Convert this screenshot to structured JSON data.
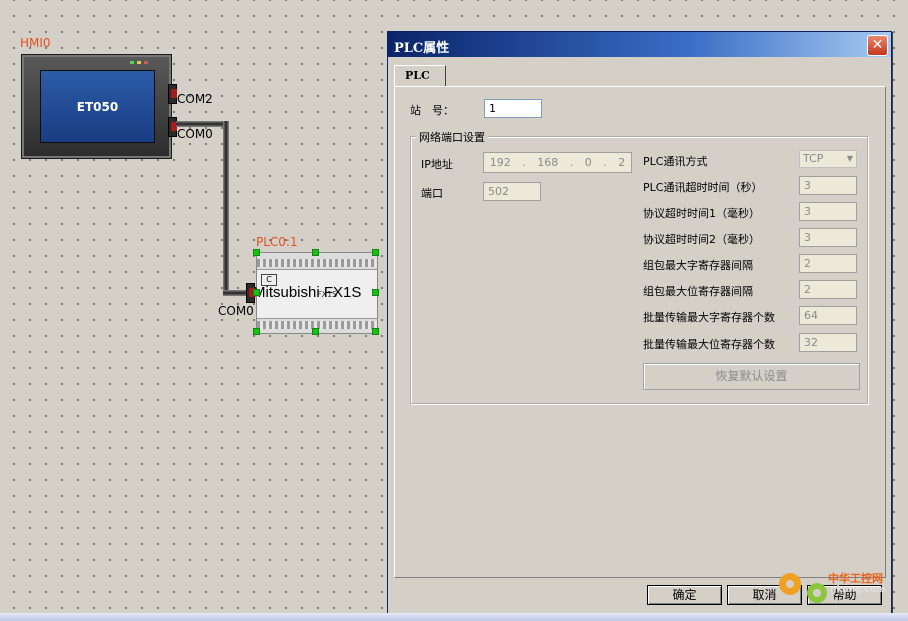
{
  "canvas": {
    "hmi": {
      "title": "HMI0",
      "screen_label": "ET050",
      "ports": [
        "COM2",
        "COM0"
      ]
    },
    "plc": {
      "title": "PLC0:1",
      "label": "Mitsubishi FX1S",
      "model_text": "FX1S",
      "port": "COM0"
    }
  },
  "dialog": {
    "title": "PLC属性",
    "close_glyph": "✕",
    "tab_label": "PLC",
    "station_label": "站　号：",
    "station_value": "1",
    "group_title": "网络端口设置",
    "ip_label": "IP地址",
    "ip_octets": [
      "192",
      "168",
      "0",
      "2"
    ],
    "ip_separators": [
      ".",
      ".",
      "."
    ],
    "port_label": "端口",
    "port_value": "502",
    "settings": [
      {
        "label": "PLC通讯方式",
        "value": "TCP"
      },
      {
        "label": "PLC通讯超时时间（秒）",
        "value": "3"
      },
      {
        "label": "协议超时时间1（毫秒）",
        "value": "3"
      },
      {
        "label": "协议超时时间2（毫秒）",
        "value": "3"
      },
      {
        "label": "组包最大字寄存器间隔",
        "value": "2"
      },
      {
        "label": "组包最大位寄存器间隔",
        "value": "2"
      },
      {
        "label": "批量传输最大字寄存器个数",
        "value": "64"
      },
      {
        "label": "批量传输最大位寄存器个数",
        "value": "32"
      }
    ],
    "restore_button": "恢复默认设置",
    "ok_button": "确定",
    "cancel_button": "取消",
    "help_button": "帮助"
  },
  "watermark": {
    "line1": "中华工控网",
    "line2": "gkong.com"
  },
  "colors": {
    "title_red": "#e0501f",
    "selection_green": "#18c018",
    "titlebar": "#0a246a"
  }
}
